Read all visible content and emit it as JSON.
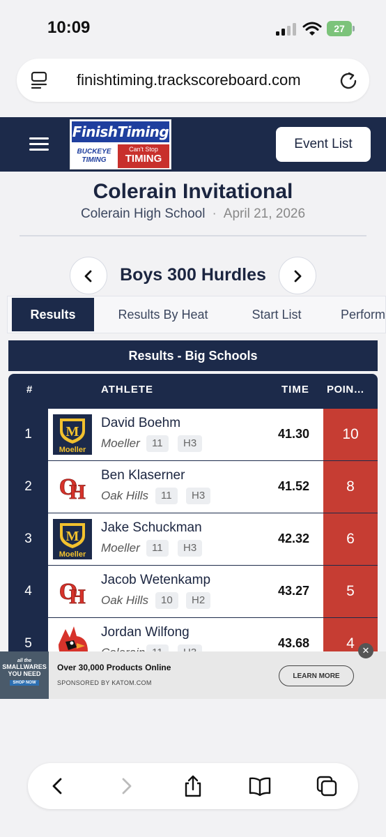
{
  "status_bar": {
    "time": "10:09",
    "battery": "27"
  },
  "browser": {
    "url": "finishtiming.trackscoreboard.com"
  },
  "header": {
    "logo_top": "FinishTiming",
    "logo_left": "BUCKEYE TIMING",
    "logo_right_small": "Can't Stop",
    "logo_right_big": "TIMING",
    "event_list_label": "Event List"
  },
  "meet": {
    "title": "Colerain Invitational",
    "school": "Colerain High School",
    "separator": "·",
    "date": "April 21, 2026"
  },
  "event": {
    "title": "Boys 300 Hurdles",
    "prev": "‹",
    "next": "›"
  },
  "tabs": [
    "Results",
    "Results By Heat",
    "Start List",
    "Perform"
  ],
  "results": {
    "section_title": "Results - Big Schools",
    "columns": {
      "place": "#",
      "athlete": "ATHLETE",
      "time": "TIME",
      "points": "POIN…"
    },
    "rows": [
      {
        "place": "1",
        "name": "David Boehm",
        "team": "Moeller",
        "grade": "11",
        "heat": "H3",
        "time": "41.30",
        "points": "10",
        "logo": "moeller-logo"
      },
      {
        "place": "2",
        "name": "Ben Klaserner",
        "team": "Oak Hills",
        "grade": "11",
        "heat": "H3",
        "time": "41.52",
        "points": "8",
        "logo": "oak-hills-logo"
      },
      {
        "place": "3",
        "name": "Jake Schuckman",
        "team": "Moeller",
        "grade": "11",
        "heat": "H3",
        "time": "42.32",
        "points": "6",
        "logo": "moeller-logo"
      },
      {
        "place": "4",
        "name": "Jacob Wetenkamp",
        "team": "Oak Hills",
        "grade": "10",
        "heat": "H2",
        "time": "43.27",
        "points": "5",
        "logo": "oak-hills-logo"
      },
      {
        "place": "5",
        "name": "Jordan Wilfong",
        "team": "Colerain",
        "grade": "11",
        "heat": "H3",
        "time": "43.68",
        "points": "4",
        "logo": "colerain-cardinal-logo"
      }
    ]
  },
  "ad": {
    "image_line1": "all the",
    "image_line2": "SMALLWARES YOU NEED",
    "image_line3": "SHOP NOW",
    "title": "Over 30,000 Products Online",
    "sponsor": "SPONSORED BY KATOM.COM",
    "cta": "LEARN MORE",
    "close": "✕"
  },
  "colors": {
    "navy": "#1c2a4a",
    "points_red": "#c63d33",
    "moeller_gold": "#f2c12e"
  },
  "icons": [
    "page-icon",
    "reload-icon",
    "menu-icon",
    "back-icon",
    "forward-icon",
    "share-icon",
    "bookmarks-icon",
    "tabs-icon"
  ]
}
